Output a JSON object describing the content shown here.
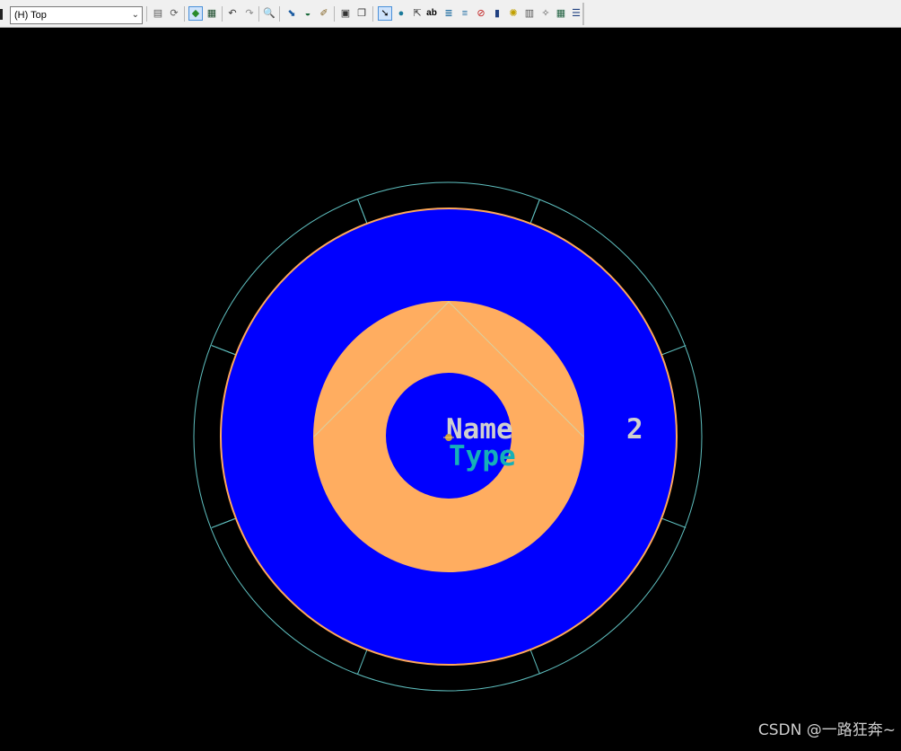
{
  "toolbar": {
    "layer_value": "(H) Top",
    "buttons": [
      {
        "name": "layer-properties-icon",
        "glyph": "▤",
        "color": "#5a5a5a"
      },
      {
        "name": "refresh-icon",
        "glyph": "⟳",
        "color": "#5a5a5a"
      },
      {
        "name": "design-rules-icon",
        "glyph": "◆",
        "color": "#2a8a2a",
        "active": true
      },
      {
        "name": "board-view-icon",
        "glyph": "▦",
        "color": "#1a4a2a"
      },
      {
        "name": "undo-icon",
        "glyph": "↶",
        "color": "#333333"
      },
      {
        "name": "redo-icon",
        "glyph": "↷",
        "color": "#888888"
      },
      {
        "name": "zoom-icon",
        "glyph": "🔍",
        "color": "#333333"
      },
      {
        "name": "route-icon",
        "glyph": "⬊",
        "color": "#1a5aa0"
      },
      {
        "name": "via-icon",
        "glyph": "◒",
        "color": "#1a6a3a"
      },
      {
        "name": "brush-icon",
        "glyph": "✐",
        "color": "#806020"
      },
      {
        "name": "component-icon",
        "glyph": "▣",
        "color": "#333333"
      },
      {
        "name": "copy-icon",
        "glyph": "❐",
        "color": "#333333"
      },
      {
        "name": "select-arrow-icon",
        "glyph": "➘",
        "color": "#000000",
        "active": true
      },
      {
        "name": "globe-icon",
        "glyph": "●",
        "color": "#1a7a9a"
      },
      {
        "name": "select-drag-icon",
        "glyph": "⇱",
        "color": "#333333"
      },
      {
        "name": "text-icon",
        "glyph": "ab",
        "color": "#000000"
      },
      {
        "name": "layer-stack-icon",
        "glyph": "≣",
        "color": "#1a6aa0"
      },
      {
        "name": "layers-icon",
        "glyph": "≡",
        "color": "#1a6aa0"
      },
      {
        "name": "no-icon",
        "glyph": "⊘",
        "color": "#c02020"
      },
      {
        "name": "pins-icon",
        "glyph": "▮",
        "color": "#204080"
      },
      {
        "name": "burst-icon",
        "glyph": "✺",
        "color": "#c0a000"
      },
      {
        "name": "table-edit-icon",
        "glyph": "▥",
        "color": "#555555"
      },
      {
        "name": "settings-icon",
        "glyph": "✧",
        "color": "#555555"
      },
      {
        "name": "grid-icon",
        "glyph": "▦",
        "color": "#206040"
      },
      {
        "name": "list-icon",
        "glyph": "☰",
        "color": "#204080"
      }
    ]
  },
  "canvas": {
    "background": "#000000",
    "pad": {
      "outer_ring_color": "#5fc0c0",
      "pad_color": "#0000ff",
      "pad_outline_color": "#ffa85a",
      "inner_ring_color": "#ffad60",
      "drill_color": "#0000ff",
      "guide_line_color": "#d8d0a0"
    },
    "labels": {
      "name": "Name",
      "type": "Type",
      "pin_number": "2"
    },
    "label_colors": {
      "name": "#cfcfcf",
      "type": "#15b0b8",
      "pin_number": "#cfcfcf"
    }
  },
  "watermark": "CSDN @一路狂奔~"
}
